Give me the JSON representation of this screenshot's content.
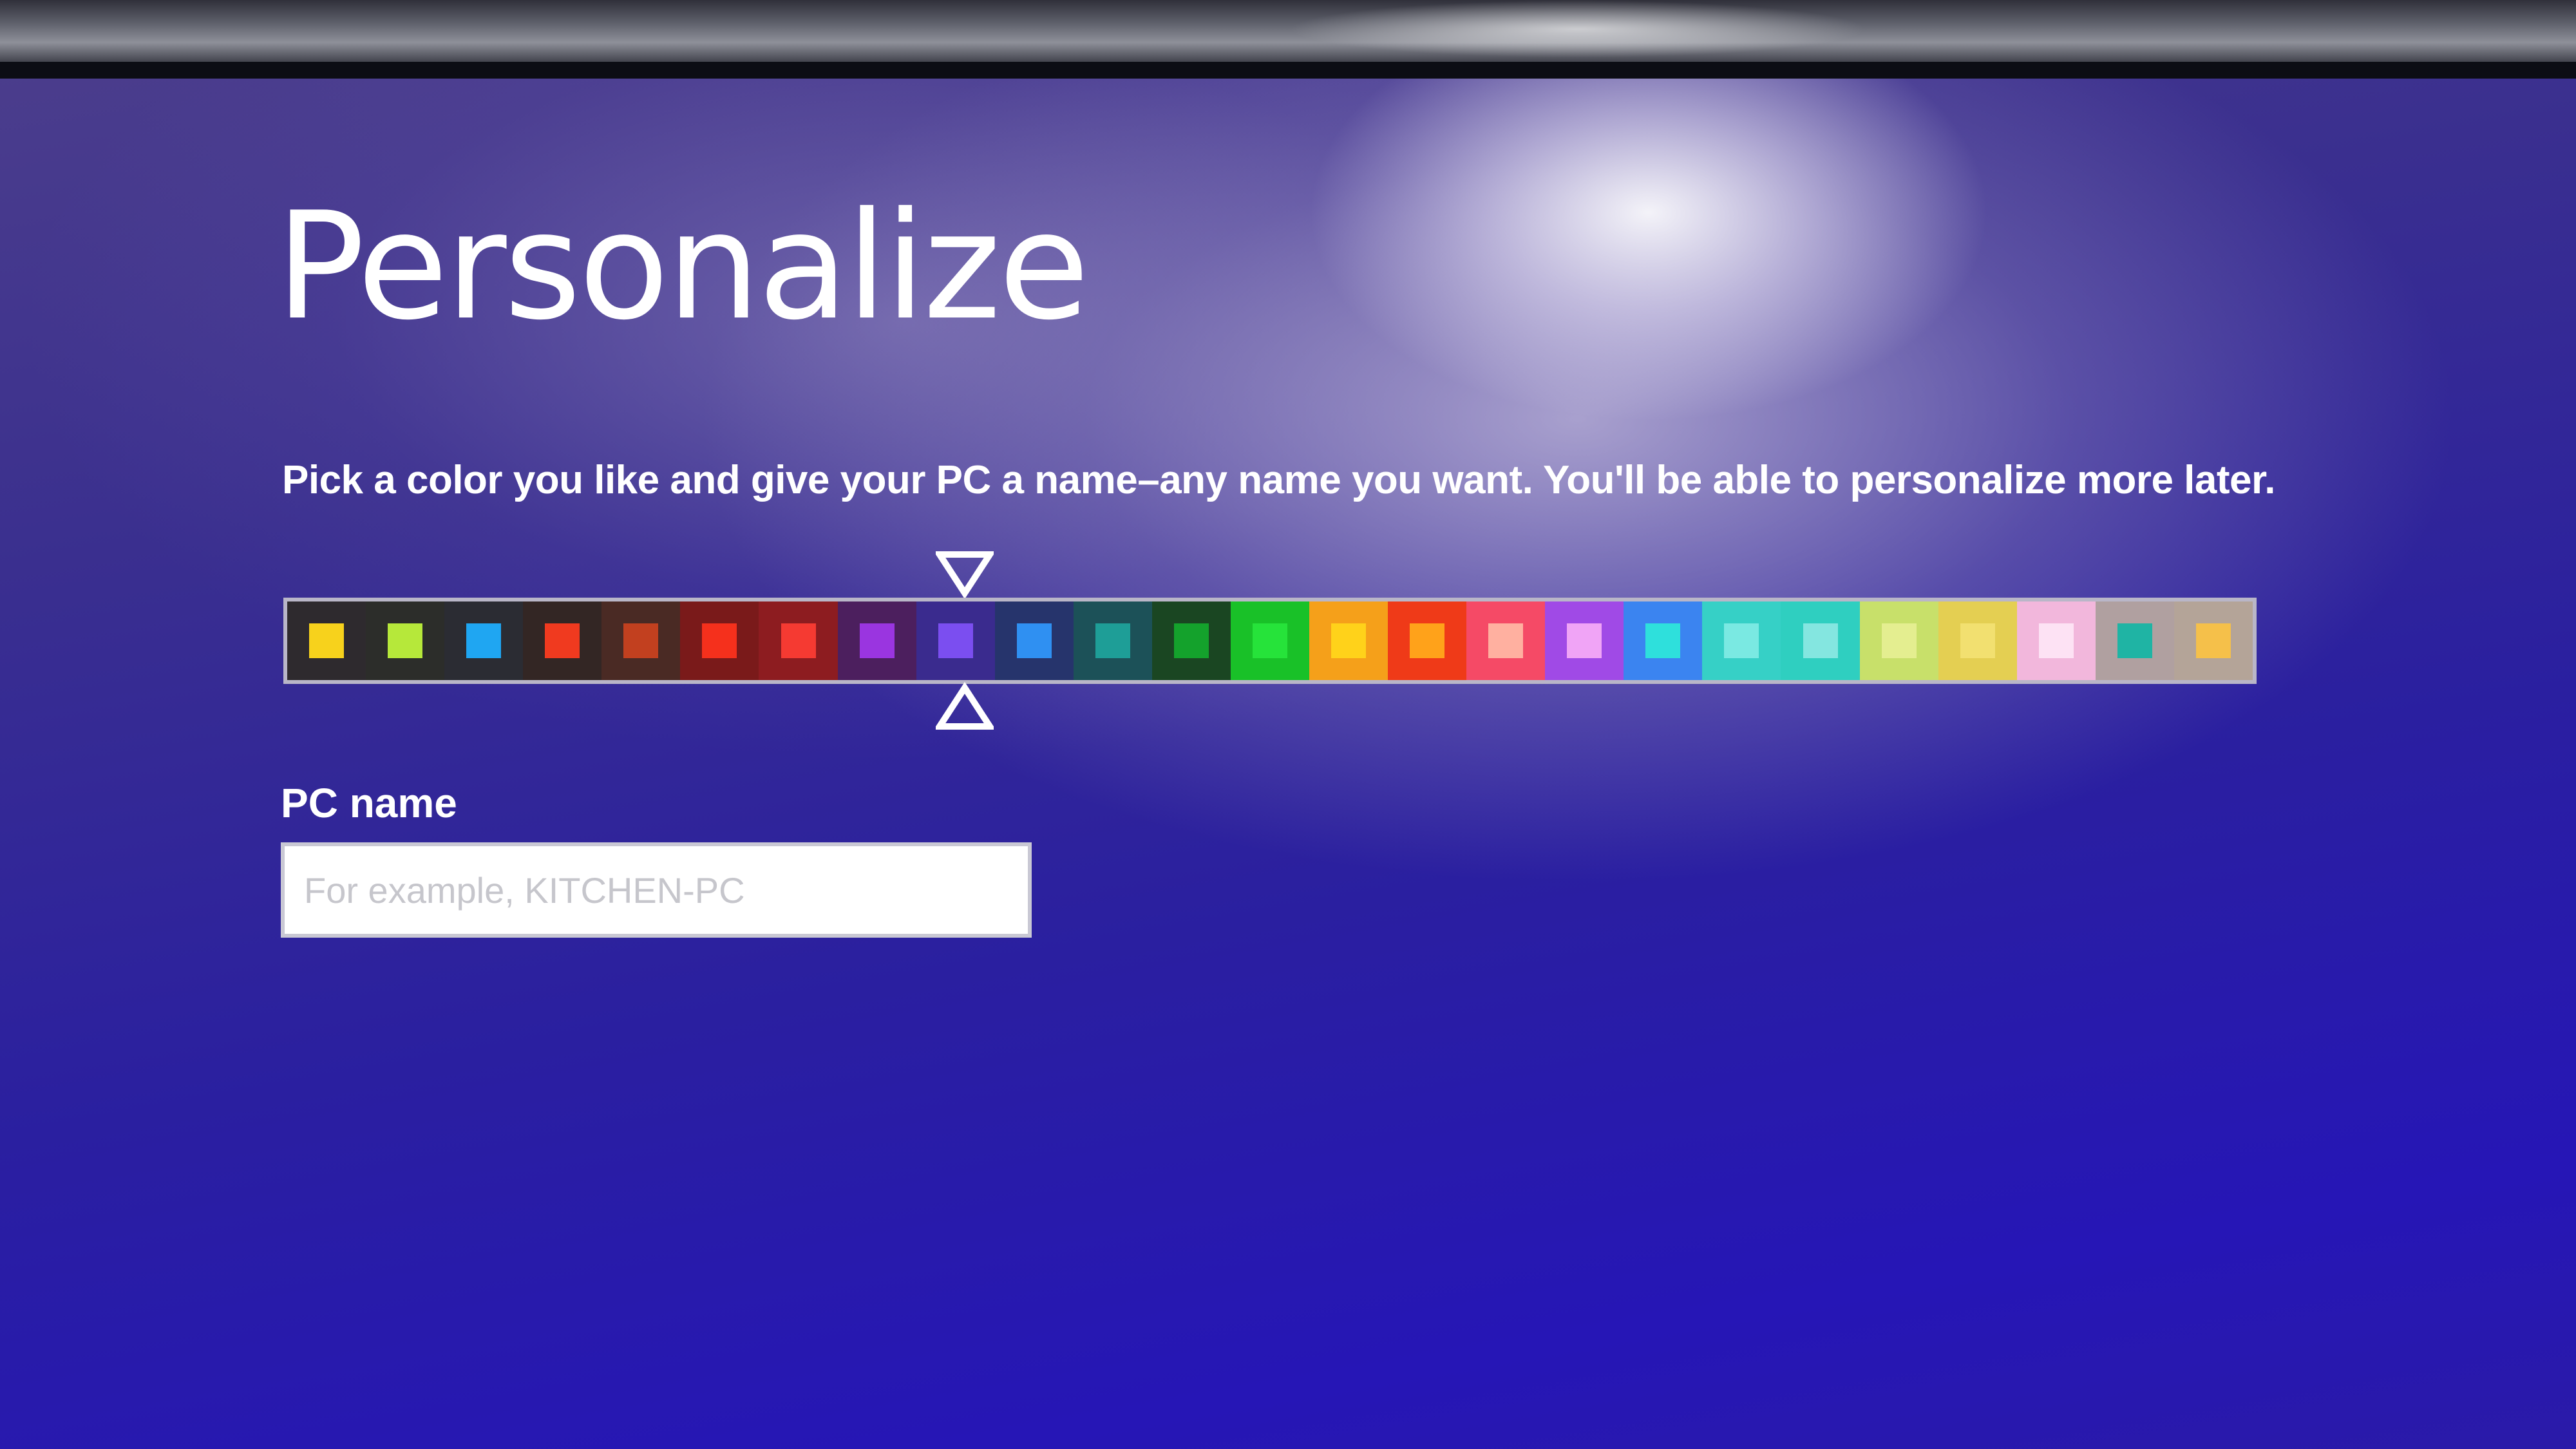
{
  "header": {
    "title": "Personalize",
    "description": "Pick a color you like and give your PC a name–any name you want. You'll be able to personalize more later."
  },
  "color_picker": {
    "selected_index": 8,
    "swatches": [
      {
        "background": "#2e2a2e",
        "chip": "#f7d21c"
      },
      {
        "background": "#2c2d2a",
        "chip": "#b6e83a"
      },
      {
        "background": "#2b2c33",
        "chip": "#1fa6f2"
      },
      {
        "background": "#332624",
        "chip": "#f03a1f"
      },
      {
        "background": "#4a2a24",
        "chip": "#c2401f"
      },
      {
        "background": "#7a1a1a",
        "chip": "#f5301c"
      },
      {
        "background": "#8d1c20",
        "chip": "#f53a32"
      },
      {
        "background": "#4c1f5e",
        "chip": "#9a35e0"
      },
      {
        "background": "#3a2b8e",
        "chip": "#7b4ef0"
      },
      {
        "background": "#26346c",
        "chip": "#2f90f2"
      },
      {
        "background": "#1c5158",
        "chip": "#1e9e97"
      },
      {
        "background": "#1a4622",
        "chip": "#14a22c"
      },
      {
        "background": "#19c128",
        "chip": "#26e33a"
      },
      {
        "background": "#f5a01a",
        "chip": "#ffd21a"
      },
      {
        "background": "#ef3a18",
        "chip": "#ffa21a"
      },
      {
        "background": "#f54a66",
        "chip": "#ffb0a0"
      },
      {
        "background": "#a04ae6",
        "chip": "#f0a4f6"
      },
      {
        "background": "#3b84f0",
        "chip": "#2ee0dc"
      },
      {
        "background": "#36d0c6",
        "chip": "#7ae9e2"
      },
      {
        "background": "#2fcfc0",
        "chip": "#84e6e0"
      },
      {
        "background": "#c8e06a",
        "chip": "#e4ee90"
      },
      {
        "background": "#e4cf52",
        "chip": "#f2e070"
      },
      {
        "background": "#f2b7dc",
        "chip": "#fde2f4"
      },
      {
        "background": "#b0a0a0",
        "chip": "#1fb4a4"
      },
      {
        "background": "#b4a498",
        "chip": "#f5c04a"
      }
    ]
  },
  "pc_name": {
    "label": "PC name",
    "value": "",
    "placeholder": "For example, KITCHEN-PC"
  }
}
